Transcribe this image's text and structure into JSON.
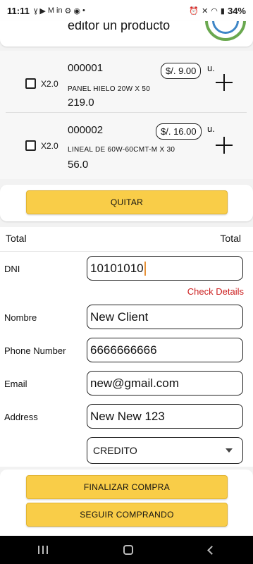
{
  "status_bar": {
    "time": "11:11",
    "icons": [
      "gesture-icon",
      "video-icon",
      "gmail-icon",
      "linkedin-icon",
      "gear-icon",
      "spotify-icon",
      "dot-icon"
    ],
    "battery": "34%"
  },
  "header": {
    "title": "editor un producto"
  },
  "items": [
    {
      "qty": "X2.0",
      "code": "000001",
      "description": "PANEL HIELO 20W X 50",
      "total": "219.0",
      "price": "$/. 9.00",
      "unit": "u."
    },
    {
      "qty": "X2.0",
      "code": "000002",
      "description": "LINEAL DE 60W-60CMT-M X 30",
      "total": "56.0",
      "price": "$/. 16.00",
      "unit": "u."
    }
  ],
  "actions": {
    "remove_label": "QUITAR",
    "finish_label": "FINALIZAR COMPRA",
    "continue_label": "SEGUIR COMPRANDO"
  },
  "totals": {
    "left_label": "Total",
    "right_label": "Total"
  },
  "form": {
    "dni_label": "DNI",
    "dni_value": "10101010",
    "check_details": "Check Details",
    "name_label": "Nombre",
    "name_value": "New Client",
    "phone_label": "Phone Number",
    "phone_value": "6666666666",
    "email_label": "Email",
    "email_value": "new@gmail.com",
    "address_label": "Address",
    "address_value": "New New 123",
    "payment_selected": "CREDITO"
  },
  "colors": {
    "accent_yellow": "#f9cd48",
    "link_red": "#cc1f1f"
  }
}
